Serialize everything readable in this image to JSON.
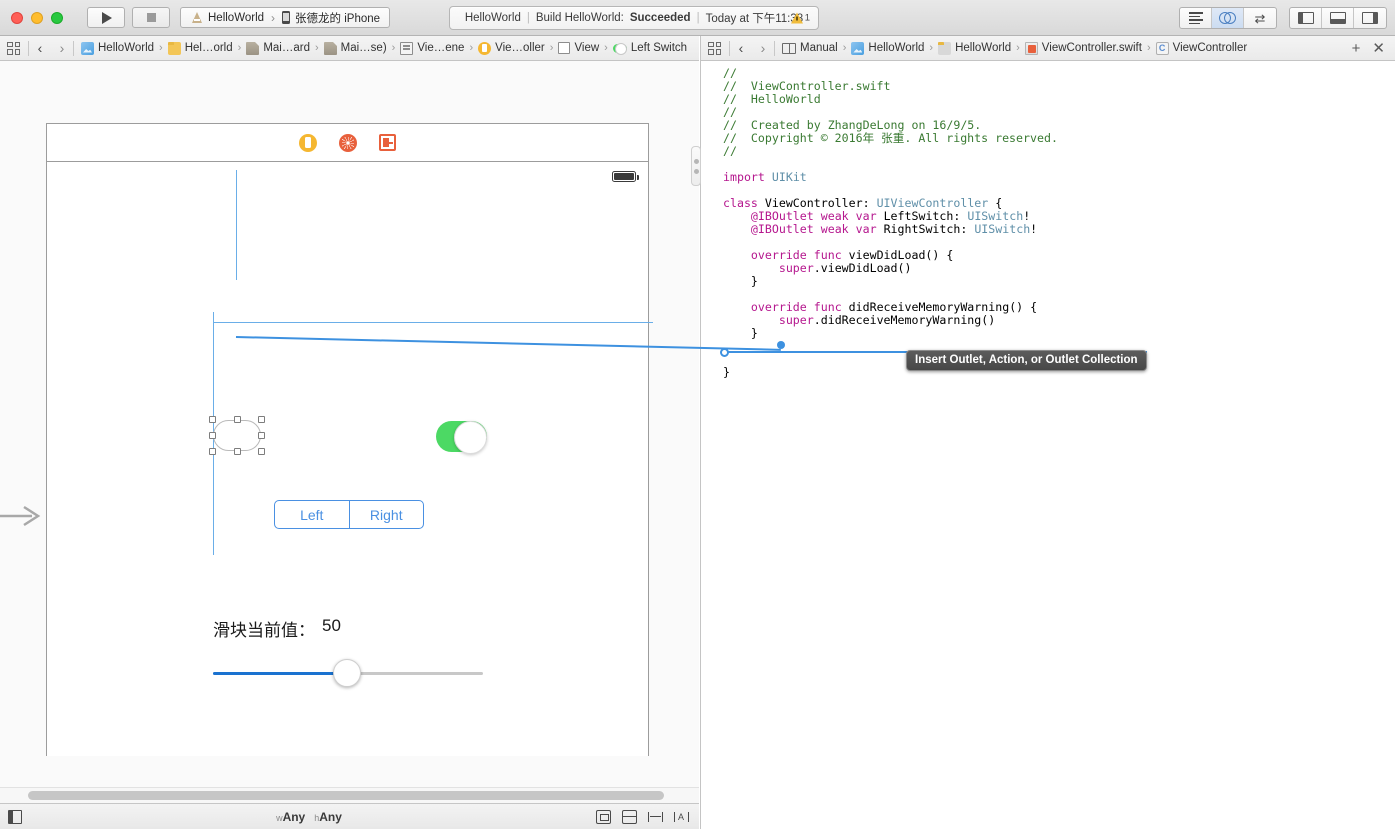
{
  "toolbar": {
    "run_label": "Run",
    "stop_label": "Stop",
    "scheme_project": "HelloWorld",
    "scheme_device": "张德龙的 iPhone",
    "activity_project": "HelloWorld",
    "activity_status_prefix": "Build HelloWorld:",
    "activity_status": "Succeeded",
    "activity_time": "Today at 下午11:38",
    "warning_count": "1",
    "editor_modes": [
      "standard-editor",
      "assistant-editor",
      "version-editor"
    ],
    "active_editor_mode": "assistant-editor",
    "view_toggles": [
      "navigator-pane",
      "debug-pane",
      "utilities-pane"
    ]
  },
  "left_jumpbar": {
    "back_label": "‹",
    "forward_label": "›",
    "crumbs": [
      {
        "icon": "project-icon",
        "label": "HelloWorld"
      },
      {
        "icon": "folder-icon",
        "label": "Hel…orld"
      },
      {
        "icon": "file-icon",
        "label": "Mai…ard"
      },
      {
        "icon": "file-icon",
        "label": "Mai…se)"
      },
      {
        "icon": "scene-icon",
        "label": "Vie…ene"
      },
      {
        "icon": "viewcontroller-icon",
        "label": "Vie…oller"
      },
      {
        "icon": "view-icon",
        "label": "View"
      },
      {
        "icon": "switch-icon",
        "label": "Left Switch"
      }
    ]
  },
  "right_jumpbar": {
    "back_label": "‹",
    "forward_label": "›",
    "crumbs": [
      {
        "icon": "manual-icon",
        "label": "Manual"
      },
      {
        "icon": "project-icon",
        "label": "HelloWorld"
      },
      {
        "icon": "folder-icon",
        "label": "HelloWorld"
      },
      {
        "icon": "swift-icon",
        "label": "ViewController.swift"
      },
      {
        "icon": "class-icon",
        "label": "ViewController"
      }
    ],
    "add_label": "+",
    "close_label": "✕"
  },
  "canvas": {
    "scene_dock": [
      {
        "name": "view-controller-dock-icon",
        "title": "View Controller"
      },
      {
        "name": "first-responder-dock-icon",
        "title": "First Responder"
      },
      {
        "name": "exit-dock-icon",
        "title": "Exit"
      }
    ],
    "segmented_control": {
      "options": [
        "Left",
        "Right"
      ],
      "selected": "Left"
    },
    "slider_label": "滑块当前值：",
    "slider_value": "50",
    "left_switch": {
      "name": "Left Switch",
      "on": false,
      "selected": true
    },
    "right_switch": {
      "name": "Right Switch",
      "on": true,
      "selected": false
    },
    "accent_switch_on_color": "#4cd964",
    "accent_tint_color": "#4a90e2",
    "connection_color": "#3d91e0"
  },
  "status_bar": {
    "size_class_width_prefix": "w",
    "size_class_width": "Any",
    "size_class_height_prefix": "h",
    "size_class_height": "Any",
    "icons": [
      "show-document-outline-icon",
      "align-icon",
      "pin-icon",
      "resolve-issues-icon",
      "stack-icon"
    ]
  },
  "tooltip": {
    "text": "Insert Outlet, Action, or Outlet Collection"
  },
  "editor": {
    "code_lines": [
      {
        "t": "cm",
        "s": "//"
      },
      {
        "t": "cm",
        "s": "//  ViewController.swift"
      },
      {
        "t": "cm",
        "s": "//  HelloWorld"
      },
      {
        "t": "cm",
        "s": "//"
      },
      {
        "t": "cm",
        "s": "//  Created by ZhangDeLong on 16/9/5."
      },
      {
        "t": "cm",
        "s": "//  Copyright © 2016年 张重. All rights reserved."
      },
      {
        "t": "cm",
        "s": "//"
      },
      {
        "t": "pl",
        "s": ""
      },
      {
        "t": "mix",
        "s": "import UIKit"
      },
      {
        "t": "pl",
        "s": ""
      },
      {
        "t": "mix",
        "s": "class ViewController: UIViewController {"
      },
      {
        "t": "mix",
        "s": "    @IBOutlet weak var LeftSwitch: UISwitch!"
      },
      {
        "t": "mix",
        "s": "    @IBOutlet weak var RightSwitch: UISwitch!"
      },
      {
        "t": "pl",
        "s": ""
      },
      {
        "t": "mix",
        "s": "    override func viewDidLoad() {"
      },
      {
        "t": "mix",
        "s": "        super.viewDidLoad()"
      },
      {
        "t": "pl",
        "s": "    }"
      },
      {
        "t": "pl",
        "s": ""
      },
      {
        "t": "mix",
        "s": "    override func didReceiveMemoryWarning() {"
      },
      {
        "t": "mix",
        "s": "        super.didReceiveMemoryWarning()"
      },
      {
        "t": "pl",
        "s": "    }"
      },
      {
        "t": "pl",
        "s": ""
      },
      {
        "t": "pl",
        "s": ""
      },
      {
        "t": "pl",
        "s": "}"
      }
    ],
    "code_html": "<span class=\"cm\">//</span>\n<span class=\"cm\">//  ViewController.swift</span>\n<span class=\"cm\">//  HelloWorld</span>\n<span class=\"cm\">//</span>\n<span class=\"cm\">//  Created by ZhangDeLong on 16/9/5.</span>\n<span class=\"cm\">//  Copyright © 2016年 张重. All rights reserved.</span>\n<span class=\"cm\">//</span>\n\n<span class=\"kw\">import</span> <span class=\"ty\">UIKit</span>\n\n<span class=\"kw\">class</span> ViewController: <span class=\"ty\">UIViewController</span> {\n    <span class=\"kw\">@IBOutlet</span> <span class=\"kw\">weak</span> <span class=\"kw\">var</span> LeftSwitch: <span class=\"ty\">UISwitch</span>!\n    <span class=\"kw\">@IBOutlet</span> <span class=\"kw\">weak</span> <span class=\"kw\">var</span> RightSwitch: <span class=\"ty\">UISwitch</span>!\n\n    <span class=\"kw\">override</span> <span class=\"kw\">func</span> viewDidLoad() {\n        <span class=\"kw\">super</span>.viewDidLoad()\n    }\n\n    <span class=\"kw\">override</span> <span class=\"kw\">func</span> didReceiveMemoryWarning() {\n        <span class=\"kw\">super</span>.didReceiveMemoryWarning()\n    }\n\n\n}"
  }
}
